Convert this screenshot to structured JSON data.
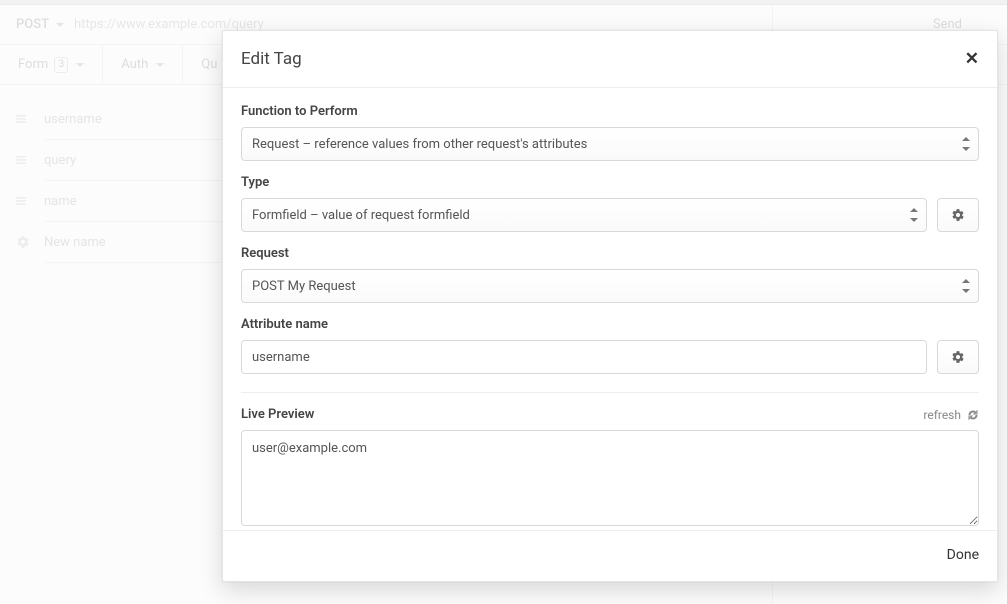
{
  "request": {
    "method": "POST",
    "url": "https://www.example.com/query",
    "send_label": "Send"
  },
  "tabs": {
    "form": {
      "label": "Form",
      "count": "3"
    },
    "auth": {
      "label": "Auth"
    },
    "query_partial": "Qu"
  },
  "form_fields": [
    {
      "name": "username"
    },
    {
      "name": "query"
    },
    {
      "name": "name"
    }
  ],
  "new_field_placeholder": "New name",
  "modal": {
    "title": "Edit Tag",
    "labels": {
      "function": "Function to Perform",
      "type": "Type",
      "request": "Request",
      "attr": "Attribute name",
      "preview": "Live Preview"
    },
    "values": {
      "function": "Request – reference values from other request's attributes",
      "type": "Formfield – value of request formfield",
      "request": "POST My Request",
      "attr": "username",
      "preview": "user@example.com"
    },
    "refresh_label": "refresh",
    "done_label": "Done"
  }
}
